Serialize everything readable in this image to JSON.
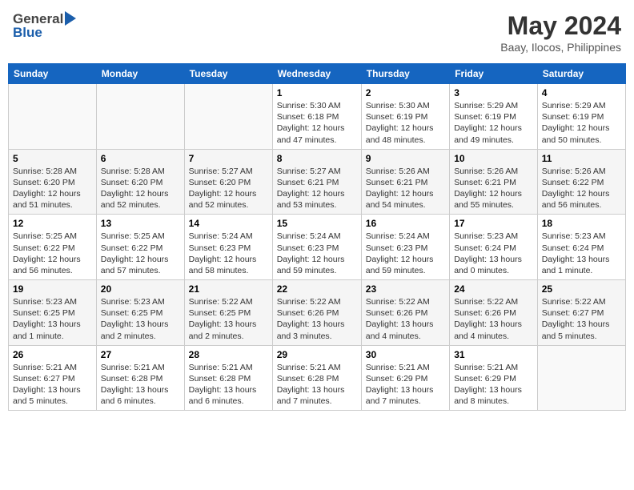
{
  "header": {
    "logo_general": "General",
    "logo_blue": "Blue",
    "month_title": "May 2024",
    "location": "Baay, Ilocos, Philippines"
  },
  "weekdays": [
    "Sunday",
    "Monday",
    "Tuesday",
    "Wednesday",
    "Thursday",
    "Friday",
    "Saturday"
  ],
  "weeks": [
    [
      {
        "day": "",
        "sunrise": "",
        "sunset": "",
        "daylight": ""
      },
      {
        "day": "",
        "sunrise": "",
        "sunset": "",
        "daylight": ""
      },
      {
        "day": "",
        "sunrise": "",
        "sunset": "",
        "daylight": ""
      },
      {
        "day": "1",
        "sunrise": "Sunrise: 5:30 AM",
        "sunset": "Sunset: 6:18 PM",
        "daylight": "Daylight: 12 hours and 47 minutes."
      },
      {
        "day": "2",
        "sunrise": "Sunrise: 5:30 AM",
        "sunset": "Sunset: 6:19 PM",
        "daylight": "Daylight: 12 hours and 48 minutes."
      },
      {
        "day": "3",
        "sunrise": "Sunrise: 5:29 AM",
        "sunset": "Sunset: 6:19 PM",
        "daylight": "Daylight: 12 hours and 49 minutes."
      },
      {
        "day": "4",
        "sunrise": "Sunrise: 5:29 AM",
        "sunset": "Sunset: 6:19 PM",
        "daylight": "Daylight: 12 hours and 50 minutes."
      }
    ],
    [
      {
        "day": "5",
        "sunrise": "Sunrise: 5:28 AM",
        "sunset": "Sunset: 6:20 PM",
        "daylight": "Daylight: 12 hours and 51 minutes."
      },
      {
        "day": "6",
        "sunrise": "Sunrise: 5:28 AM",
        "sunset": "Sunset: 6:20 PM",
        "daylight": "Daylight: 12 hours and 52 minutes."
      },
      {
        "day": "7",
        "sunrise": "Sunrise: 5:27 AM",
        "sunset": "Sunset: 6:20 PM",
        "daylight": "Daylight: 12 hours and 52 minutes."
      },
      {
        "day": "8",
        "sunrise": "Sunrise: 5:27 AM",
        "sunset": "Sunset: 6:21 PM",
        "daylight": "Daylight: 12 hours and 53 minutes."
      },
      {
        "day": "9",
        "sunrise": "Sunrise: 5:26 AM",
        "sunset": "Sunset: 6:21 PM",
        "daylight": "Daylight: 12 hours and 54 minutes."
      },
      {
        "day": "10",
        "sunrise": "Sunrise: 5:26 AM",
        "sunset": "Sunset: 6:21 PM",
        "daylight": "Daylight: 12 hours and 55 minutes."
      },
      {
        "day": "11",
        "sunrise": "Sunrise: 5:26 AM",
        "sunset": "Sunset: 6:22 PM",
        "daylight": "Daylight: 12 hours and 56 minutes."
      }
    ],
    [
      {
        "day": "12",
        "sunrise": "Sunrise: 5:25 AM",
        "sunset": "Sunset: 6:22 PM",
        "daylight": "Daylight: 12 hours and 56 minutes."
      },
      {
        "day": "13",
        "sunrise": "Sunrise: 5:25 AM",
        "sunset": "Sunset: 6:22 PM",
        "daylight": "Daylight: 12 hours and 57 minutes."
      },
      {
        "day": "14",
        "sunrise": "Sunrise: 5:24 AM",
        "sunset": "Sunset: 6:23 PM",
        "daylight": "Daylight: 12 hours and 58 minutes."
      },
      {
        "day": "15",
        "sunrise": "Sunrise: 5:24 AM",
        "sunset": "Sunset: 6:23 PM",
        "daylight": "Daylight: 12 hours and 59 minutes."
      },
      {
        "day": "16",
        "sunrise": "Sunrise: 5:24 AM",
        "sunset": "Sunset: 6:23 PM",
        "daylight": "Daylight: 12 hours and 59 minutes."
      },
      {
        "day": "17",
        "sunrise": "Sunrise: 5:23 AM",
        "sunset": "Sunset: 6:24 PM",
        "daylight": "Daylight: 13 hours and 0 minutes."
      },
      {
        "day": "18",
        "sunrise": "Sunrise: 5:23 AM",
        "sunset": "Sunset: 6:24 PM",
        "daylight": "Daylight: 13 hours and 1 minute."
      }
    ],
    [
      {
        "day": "19",
        "sunrise": "Sunrise: 5:23 AM",
        "sunset": "Sunset: 6:25 PM",
        "daylight": "Daylight: 13 hours and 1 minute."
      },
      {
        "day": "20",
        "sunrise": "Sunrise: 5:23 AM",
        "sunset": "Sunset: 6:25 PM",
        "daylight": "Daylight: 13 hours and 2 minutes."
      },
      {
        "day": "21",
        "sunrise": "Sunrise: 5:22 AM",
        "sunset": "Sunset: 6:25 PM",
        "daylight": "Daylight: 13 hours and 2 minutes."
      },
      {
        "day": "22",
        "sunrise": "Sunrise: 5:22 AM",
        "sunset": "Sunset: 6:26 PM",
        "daylight": "Daylight: 13 hours and 3 minutes."
      },
      {
        "day": "23",
        "sunrise": "Sunrise: 5:22 AM",
        "sunset": "Sunset: 6:26 PM",
        "daylight": "Daylight: 13 hours and 4 minutes."
      },
      {
        "day": "24",
        "sunrise": "Sunrise: 5:22 AM",
        "sunset": "Sunset: 6:26 PM",
        "daylight": "Daylight: 13 hours and 4 minutes."
      },
      {
        "day": "25",
        "sunrise": "Sunrise: 5:22 AM",
        "sunset": "Sunset: 6:27 PM",
        "daylight": "Daylight: 13 hours and 5 minutes."
      }
    ],
    [
      {
        "day": "26",
        "sunrise": "Sunrise: 5:21 AM",
        "sunset": "Sunset: 6:27 PM",
        "daylight": "Daylight: 13 hours and 5 minutes."
      },
      {
        "day": "27",
        "sunrise": "Sunrise: 5:21 AM",
        "sunset": "Sunset: 6:28 PM",
        "daylight": "Daylight: 13 hours and 6 minutes."
      },
      {
        "day": "28",
        "sunrise": "Sunrise: 5:21 AM",
        "sunset": "Sunset: 6:28 PM",
        "daylight": "Daylight: 13 hours and 6 minutes."
      },
      {
        "day": "29",
        "sunrise": "Sunrise: 5:21 AM",
        "sunset": "Sunset: 6:28 PM",
        "daylight": "Daylight: 13 hours and 7 minutes."
      },
      {
        "day": "30",
        "sunrise": "Sunrise: 5:21 AM",
        "sunset": "Sunset: 6:29 PM",
        "daylight": "Daylight: 13 hours and 7 minutes."
      },
      {
        "day": "31",
        "sunrise": "Sunrise: 5:21 AM",
        "sunset": "Sunset: 6:29 PM",
        "daylight": "Daylight: 13 hours and 8 minutes."
      },
      {
        "day": "",
        "sunrise": "",
        "sunset": "",
        "daylight": ""
      }
    ]
  ]
}
